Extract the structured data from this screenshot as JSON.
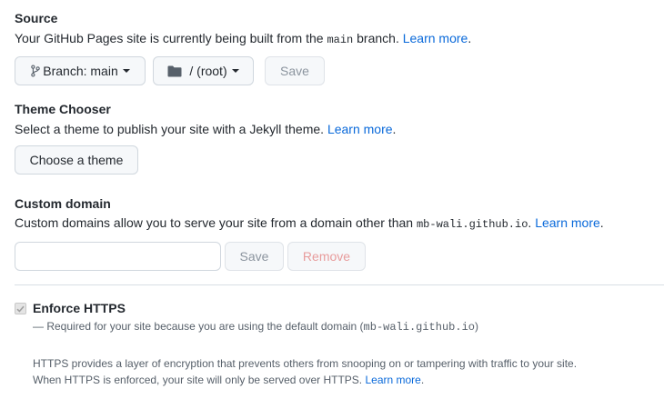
{
  "source": {
    "heading": "Source",
    "desc_before": "Your GitHub Pages site is currently being built from the ",
    "branch_code": "main",
    "desc_after": " branch. ",
    "learn_more": "Learn more",
    "trailing": ".",
    "branch_button_label": "Branch: main",
    "folder_button_label": "/ (root)",
    "save_label": "Save"
  },
  "theme": {
    "heading": "Theme Chooser",
    "desc": "Select a theme to publish your site with a Jekyll theme. ",
    "learn_more": "Learn more",
    "trailing": ".",
    "button_label": "Choose a theme"
  },
  "custom_domain": {
    "heading": "Custom domain",
    "desc_before": "Custom domains allow you to serve your site from a domain other than ",
    "domain_code": "mb-wali.github.io",
    "desc_after": ". ",
    "learn_more": "Learn more",
    "trailing": ".",
    "input_value": "",
    "input_placeholder": "",
    "save_label": "Save",
    "remove_label": "Remove"
  },
  "https": {
    "label": "Enforce HTTPS",
    "checked": true,
    "note_before": "— Required for your site because you are using the default domain (",
    "note_code": "mb-wali.github.io",
    "note_after": ")",
    "info_line1": "HTTPS provides a layer of encryption that prevents others from snooping on or tampering with traffic to your site.",
    "info_line2": "When HTTPS is enforced, your site will only be served over HTTPS. ",
    "learn_more": "Learn more",
    "trailing": "."
  },
  "colors": {
    "link": "#0969da",
    "text": "#24292f",
    "muted": "#57606a",
    "button_bg": "#f6f8fa",
    "border": "#d0d7de"
  },
  "icons": {
    "branch": "git-branch-icon",
    "folder": "folder-icon",
    "check": "check-icon"
  }
}
